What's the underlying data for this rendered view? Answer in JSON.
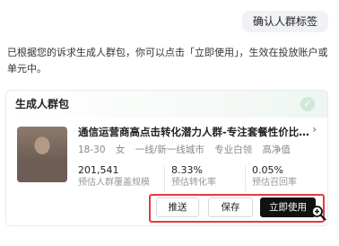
{
  "top_pill": "确认人群标签",
  "intro_text": "已根据您的诉求生成人群包，你可以点击「立即使用」，生效在投放账户或单元中。",
  "card": {
    "header": "生成人群包",
    "name": "通信运营商高点击转化潜力人群-专注套餐性价比-61...",
    "tags": [
      "18-30",
      "女",
      "一线/新一线城市",
      "专业白领",
      "高净值"
    ],
    "stats": [
      {
        "value": "201,541",
        "label": "预估人群覆盖规模"
      },
      {
        "value": "8.33%",
        "label": "预估转化率"
      },
      {
        "value": "0.05%",
        "label": "预估召回率"
      }
    ]
  },
  "buttons": {
    "push": "推送",
    "save": "保存",
    "use_now": "立即使用"
  },
  "colors": {
    "highlight_border": "#e43b3b",
    "primary_button": "#111111"
  }
}
